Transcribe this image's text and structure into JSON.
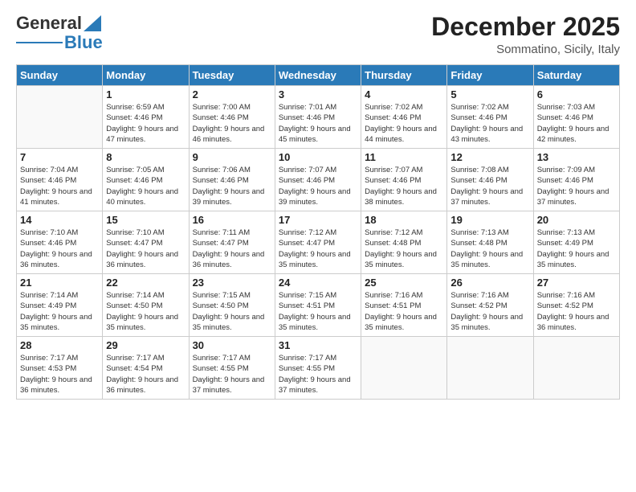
{
  "header": {
    "logo_line1": "General",
    "logo_line2": "Blue",
    "title": "December 2025",
    "subtitle": "Sommatino, Sicily, Italy"
  },
  "days_of_week": [
    "Sunday",
    "Monday",
    "Tuesday",
    "Wednesday",
    "Thursday",
    "Friday",
    "Saturday"
  ],
  "weeks": [
    [
      {
        "day": "",
        "sunrise": "",
        "sunset": "",
        "daylight": "",
        "empty": true
      },
      {
        "day": "1",
        "sunrise": "Sunrise: 6:59 AM",
        "sunset": "Sunset: 4:46 PM",
        "daylight": "Daylight: 9 hours and 47 minutes."
      },
      {
        "day": "2",
        "sunrise": "Sunrise: 7:00 AM",
        "sunset": "Sunset: 4:46 PM",
        "daylight": "Daylight: 9 hours and 46 minutes."
      },
      {
        "day": "3",
        "sunrise": "Sunrise: 7:01 AM",
        "sunset": "Sunset: 4:46 PM",
        "daylight": "Daylight: 9 hours and 45 minutes."
      },
      {
        "day": "4",
        "sunrise": "Sunrise: 7:02 AM",
        "sunset": "Sunset: 4:46 PM",
        "daylight": "Daylight: 9 hours and 44 minutes."
      },
      {
        "day": "5",
        "sunrise": "Sunrise: 7:02 AM",
        "sunset": "Sunset: 4:46 PM",
        "daylight": "Daylight: 9 hours and 43 minutes."
      },
      {
        "day": "6",
        "sunrise": "Sunrise: 7:03 AM",
        "sunset": "Sunset: 4:46 PM",
        "daylight": "Daylight: 9 hours and 42 minutes."
      }
    ],
    [
      {
        "day": "7",
        "sunrise": "Sunrise: 7:04 AM",
        "sunset": "Sunset: 4:46 PM",
        "daylight": "Daylight: 9 hours and 41 minutes."
      },
      {
        "day": "8",
        "sunrise": "Sunrise: 7:05 AM",
        "sunset": "Sunset: 4:46 PM",
        "daylight": "Daylight: 9 hours and 40 minutes."
      },
      {
        "day": "9",
        "sunrise": "Sunrise: 7:06 AM",
        "sunset": "Sunset: 4:46 PM",
        "daylight": "Daylight: 9 hours and 39 minutes."
      },
      {
        "day": "10",
        "sunrise": "Sunrise: 7:07 AM",
        "sunset": "Sunset: 4:46 PM",
        "daylight": "Daylight: 9 hours and 39 minutes."
      },
      {
        "day": "11",
        "sunrise": "Sunrise: 7:07 AM",
        "sunset": "Sunset: 4:46 PM",
        "daylight": "Daylight: 9 hours and 38 minutes."
      },
      {
        "day": "12",
        "sunrise": "Sunrise: 7:08 AM",
        "sunset": "Sunset: 4:46 PM",
        "daylight": "Daylight: 9 hours and 37 minutes."
      },
      {
        "day": "13",
        "sunrise": "Sunrise: 7:09 AM",
        "sunset": "Sunset: 4:46 PM",
        "daylight": "Daylight: 9 hours and 37 minutes."
      }
    ],
    [
      {
        "day": "14",
        "sunrise": "Sunrise: 7:10 AM",
        "sunset": "Sunset: 4:46 PM",
        "daylight": "Daylight: 9 hours and 36 minutes."
      },
      {
        "day": "15",
        "sunrise": "Sunrise: 7:10 AM",
        "sunset": "Sunset: 4:47 PM",
        "daylight": "Daylight: 9 hours and 36 minutes."
      },
      {
        "day": "16",
        "sunrise": "Sunrise: 7:11 AM",
        "sunset": "Sunset: 4:47 PM",
        "daylight": "Daylight: 9 hours and 36 minutes."
      },
      {
        "day": "17",
        "sunrise": "Sunrise: 7:12 AM",
        "sunset": "Sunset: 4:47 PM",
        "daylight": "Daylight: 9 hours and 35 minutes."
      },
      {
        "day": "18",
        "sunrise": "Sunrise: 7:12 AM",
        "sunset": "Sunset: 4:48 PM",
        "daylight": "Daylight: 9 hours and 35 minutes."
      },
      {
        "day": "19",
        "sunrise": "Sunrise: 7:13 AM",
        "sunset": "Sunset: 4:48 PM",
        "daylight": "Daylight: 9 hours and 35 minutes."
      },
      {
        "day": "20",
        "sunrise": "Sunrise: 7:13 AM",
        "sunset": "Sunset: 4:49 PM",
        "daylight": "Daylight: 9 hours and 35 minutes."
      }
    ],
    [
      {
        "day": "21",
        "sunrise": "Sunrise: 7:14 AM",
        "sunset": "Sunset: 4:49 PM",
        "daylight": "Daylight: 9 hours and 35 minutes."
      },
      {
        "day": "22",
        "sunrise": "Sunrise: 7:14 AM",
        "sunset": "Sunset: 4:50 PM",
        "daylight": "Daylight: 9 hours and 35 minutes."
      },
      {
        "day": "23",
        "sunrise": "Sunrise: 7:15 AM",
        "sunset": "Sunset: 4:50 PM",
        "daylight": "Daylight: 9 hours and 35 minutes."
      },
      {
        "day": "24",
        "sunrise": "Sunrise: 7:15 AM",
        "sunset": "Sunset: 4:51 PM",
        "daylight": "Daylight: 9 hours and 35 minutes."
      },
      {
        "day": "25",
        "sunrise": "Sunrise: 7:16 AM",
        "sunset": "Sunset: 4:51 PM",
        "daylight": "Daylight: 9 hours and 35 minutes."
      },
      {
        "day": "26",
        "sunrise": "Sunrise: 7:16 AM",
        "sunset": "Sunset: 4:52 PM",
        "daylight": "Daylight: 9 hours and 35 minutes."
      },
      {
        "day": "27",
        "sunrise": "Sunrise: 7:16 AM",
        "sunset": "Sunset: 4:52 PM",
        "daylight": "Daylight: 9 hours and 36 minutes."
      }
    ],
    [
      {
        "day": "28",
        "sunrise": "Sunrise: 7:17 AM",
        "sunset": "Sunset: 4:53 PM",
        "daylight": "Daylight: 9 hours and 36 minutes."
      },
      {
        "day": "29",
        "sunrise": "Sunrise: 7:17 AM",
        "sunset": "Sunset: 4:54 PM",
        "daylight": "Daylight: 9 hours and 36 minutes."
      },
      {
        "day": "30",
        "sunrise": "Sunrise: 7:17 AM",
        "sunset": "Sunset: 4:55 PM",
        "daylight": "Daylight: 9 hours and 37 minutes."
      },
      {
        "day": "31",
        "sunrise": "Sunrise: 7:17 AM",
        "sunset": "Sunset: 4:55 PM",
        "daylight": "Daylight: 9 hours and 37 minutes."
      },
      {
        "day": "",
        "sunrise": "",
        "sunset": "",
        "daylight": "",
        "empty": true
      },
      {
        "day": "",
        "sunrise": "",
        "sunset": "",
        "daylight": "",
        "empty": true
      },
      {
        "day": "",
        "sunrise": "",
        "sunset": "",
        "daylight": "",
        "empty": true
      }
    ]
  ]
}
